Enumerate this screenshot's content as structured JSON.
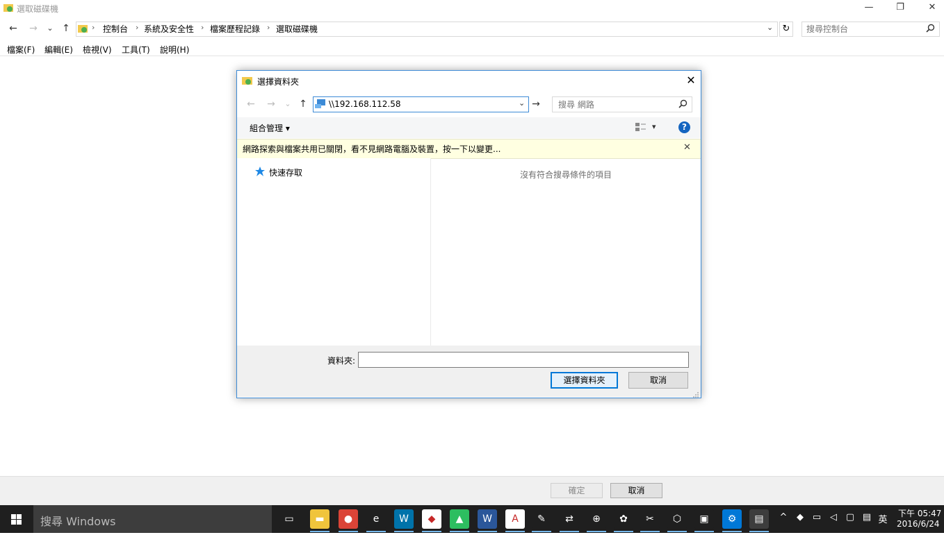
{
  "window": {
    "title": "選取磁碟機",
    "controls": {
      "minimize": "—",
      "restore": "❐",
      "close": "✕"
    }
  },
  "main_nav": {
    "back": "←",
    "forward": "→",
    "recent": "⌄",
    "up": "↑"
  },
  "breadcrumb": {
    "items": [
      "控制台",
      "系統及安全性",
      "檔案歷程記錄",
      "選取磁碟機"
    ],
    "sep": "›",
    "refresh": "↻",
    "dropdown": "⌄"
  },
  "main_search": {
    "placeholder": "搜尋控制台",
    "icon": "search-icon"
  },
  "menubar": {
    "items": [
      "檔案(F)",
      "編輯(E)",
      "檢視(V)",
      "工具(T)",
      "說明(H)"
    ]
  },
  "footer": {
    "ok_label": "確定",
    "cancel_label": "取消"
  },
  "dialog": {
    "title": "選擇資料夾",
    "close": "✕",
    "nav": {
      "back": "←",
      "forward": "→",
      "recent": "⌄",
      "up": "↑"
    },
    "address_value": "\\\\192.168.112.58",
    "address_dropdown": "⌄",
    "go": "→",
    "search_placeholder": "搜尋 網路",
    "organize_label": "組合管理 ▾",
    "help": "?",
    "view_menu": "▾",
    "infobar_text": "網路探索與檔案共用已關閉，看不見網路電腦及裝置，按一下以變更...",
    "infobar_close": "✕",
    "quick_access_label": "快速存取",
    "empty_message": "沒有符合搜尋條件的項目",
    "folder_label": "資料夾:",
    "folder_value": "",
    "select_button": "選擇資料夾",
    "cancel_button": "取消"
  },
  "taskbar": {
    "search_placeholder": "搜尋 Windows",
    "clock_time": "下午 05:47",
    "clock_date": "2016/6/24",
    "ime": "英",
    "apps": [
      {
        "name": "task-view-icon",
        "color": "#1f1f1f",
        "glyph": "▭"
      },
      {
        "name": "file-explorer-icon",
        "color": "#f0c43c",
        "glyph": "▬"
      },
      {
        "name": "chrome-icon",
        "color": "#db4437",
        "glyph": "●"
      },
      {
        "name": "internet-explorer-icon",
        "color": "#1f1f1f",
        "glyph": "e"
      },
      {
        "name": "wordpress-icon",
        "color": "#0073aa",
        "glyph": "W"
      },
      {
        "name": "dropbox-icon",
        "color": "#ffffff",
        "glyph": "◆"
      },
      {
        "name": "evernote-icon",
        "color": "#2dbe60",
        "glyph": "▲"
      },
      {
        "name": "word-icon",
        "color": "#2b579a",
        "glyph": "W"
      },
      {
        "name": "acrobat-icon",
        "color": "#ffffff",
        "glyph": "A"
      },
      {
        "name": "paint-icon",
        "color": "#1f1f1f",
        "glyph": "✎"
      },
      {
        "name": "network-icon",
        "color": "#1f1f1f",
        "glyph": "⇄"
      },
      {
        "name": "magnifier-icon",
        "color": "#1f1f1f",
        "glyph": "⊕"
      },
      {
        "name": "palette-icon",
        "color": "#1f1f1f",
        "glyph": "✿"
      },
      {
        "name": "tool-icon",
        "color": "#1f1f1f",
        "glyph": "✂"
      },
      {
        "name": "virtualbox-icon",
        "color": "#1f1f1f",
        "glyph": "⬡"
      },
      {
        "name": "remote-desktop-icon",
        "color": "#1f1f1f",
        "glyph": "▣"
      },
      {
        "name": "settings-icon",
        "color": "#0078d7",
        "glyph": "⚙"
      },
      {
        "name": "control-panel-icon",
        "color": "#3d3d3d",
        "glyph": "▤"
      }
    ]
  }
}
